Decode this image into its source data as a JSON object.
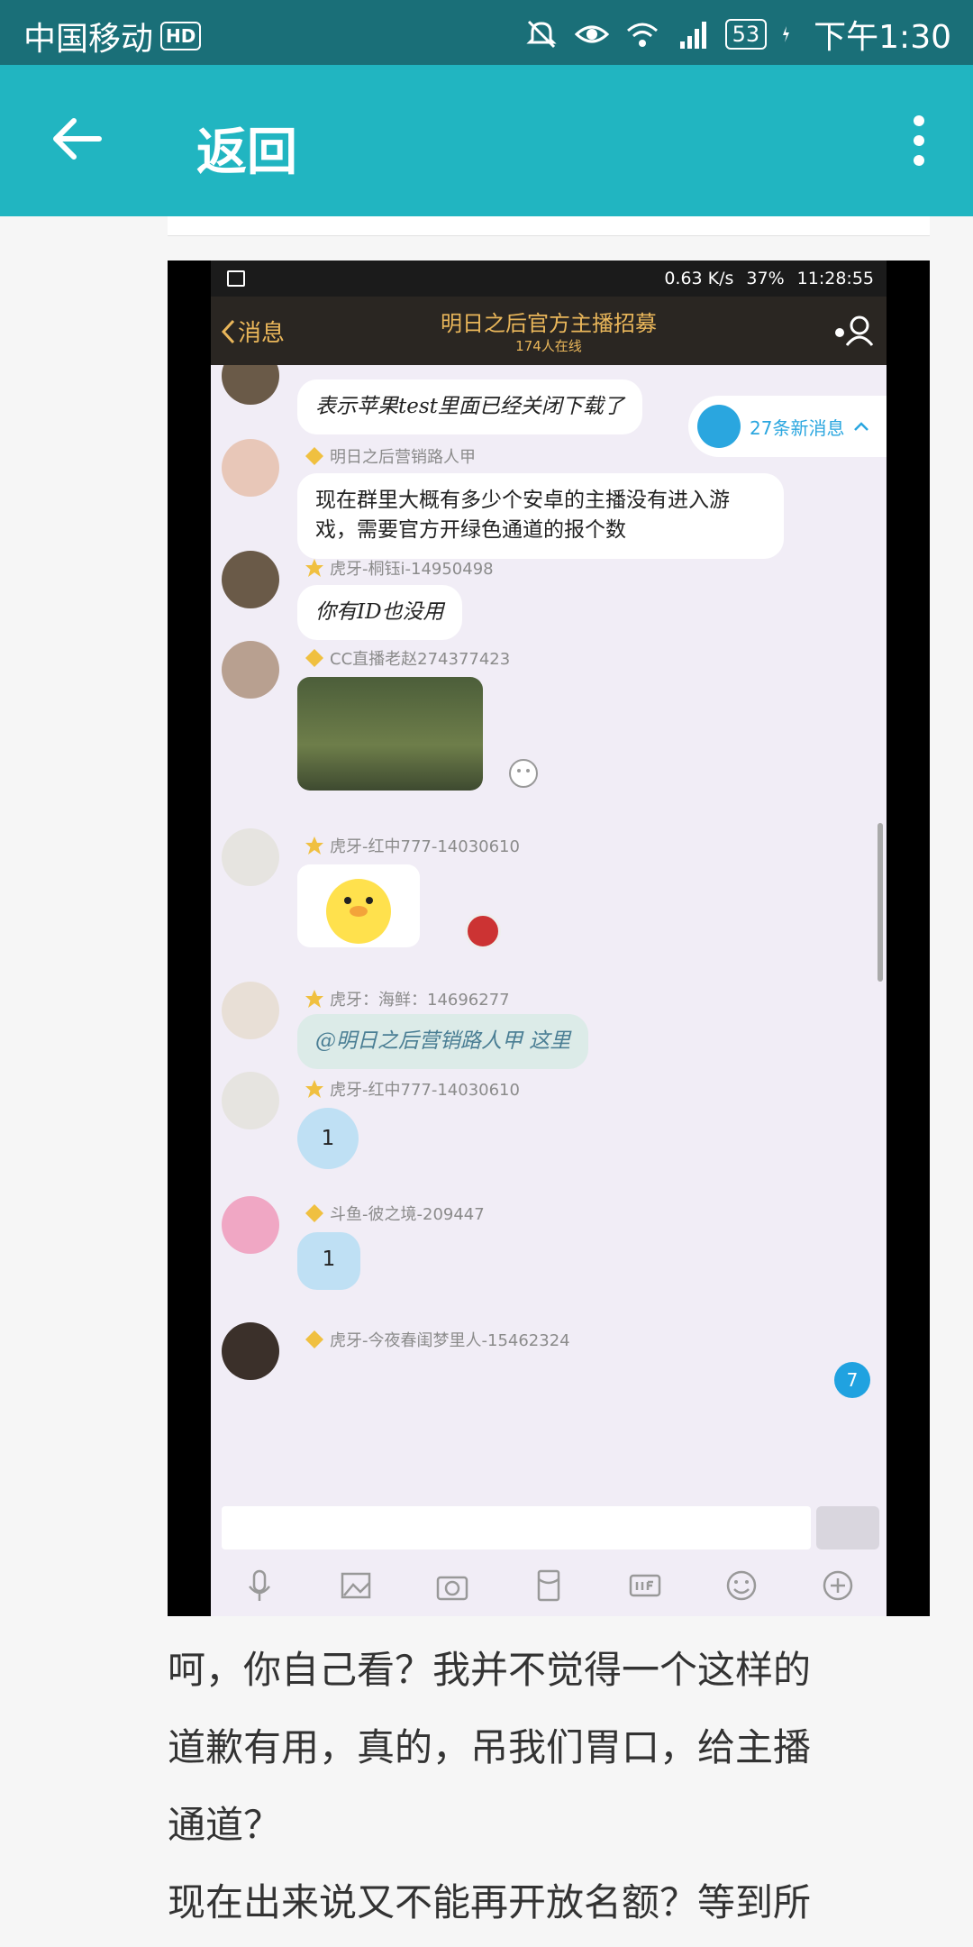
{
  "status_bar": {
    "carrier": "中国移动",
    "hd": "HD",
    "battery": "53",
    "time": "下午1:30",
    "icons": [
      "mute-icon",
      "eye-icon",
      "wifi-icon",
      "signal-4g-icon",
      "charging-icon"
    ]
  },
  "app_bar": {
    "back_icon": "arrow-left-icon",
    "title": "返回",
    "menu_icon": "more-vertical-icon"
  },
  "screenshot": {
    "status": {
      "speed": "0.63 K/s",
      "battery": "37%",
      "time": "11:28:55"
    },
    "header": {
      "back_label": "消息",
      "title": "明日之后官方主播招募",
      "online": "174人在线"
    },
    "new_messages": "27条新消息",
    "messages": [
      {
        "name": "",
        "text": "表示苹果test里面已经关闭下载了"
      },
      {
        "name": "明日之后营销路人甲",
        "text": "现在群里大概有多少个安卓的主播没有进入游戏，需要官方开绿色通道的报个数"
      },
      {
        "name": "虎牙-桐钰i-14950498",
        "text": "你有ID也没用"
      },
      {
        "name": "CC直播老赵274377423",
        "text": ""
      },
      {
        "name": "虎牙-红中777-14030610",
        "text": ""
      },
      {
        "name": "虎牙：海鲜：14696277",
        "text": "@明日之后营销路人甲 这里"
      },
      {
        "name": "虎牙-红中777-14030610",
        "text": "1"
      },
      {
        "name": "斗鱼-彼之境-209447",
        "text": "1"
      },
      {
        "name": "虎牙-今夜春闺梦里人-15462324",
        "text": ""
      }
    ],
    "unread_badge": "7",
    "toolbar_icons": [
      "mic-icon",
      "image-icon",
      "camera-icon",
      "red-packet-icon",
      "gif-icon",
      "emoji-icon",
      "plus-icon"
    ]
  },
  "post": {
    "lines": [
      "呵，你自己看？我并不觉得一个这样的",
      "道歉有用，真的，吊我们胃口，给主播",
      "通道？",
      "现在出来说又不能再开放名额？等到所"
    ]
  }
}
